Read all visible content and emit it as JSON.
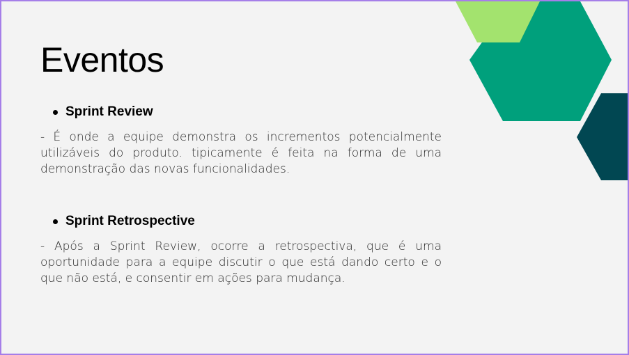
{
  "slide": {
    "title": "Eventos",
    "sections": [
      {
        "heading": "Sprint Review",
        "body": "- É onde a equipe demonstra os incrementos potencialmente utilizáveis do produto. tipicamente é feita na forma de uma demonstração das novas funcionalidades."
      },
      {
        "heading": "Sprint Retrospective",
        "body": "- Após a Sprint Review, ocorre a retrospectiva, que é uma oportunidade para a equipe discutir o que está dando certo e o que não está, e consentir em ações para mudança."
      }
    ]
  },
  "colors": {
    "background": "#f3f3f3",
    "border": "#a57ee8",
    "hexagon_light_green": "#a3e36e",
    "hexagon_teal": "#00a07c",
    "hexagon_dark_teal": "#014752"
  }
}
